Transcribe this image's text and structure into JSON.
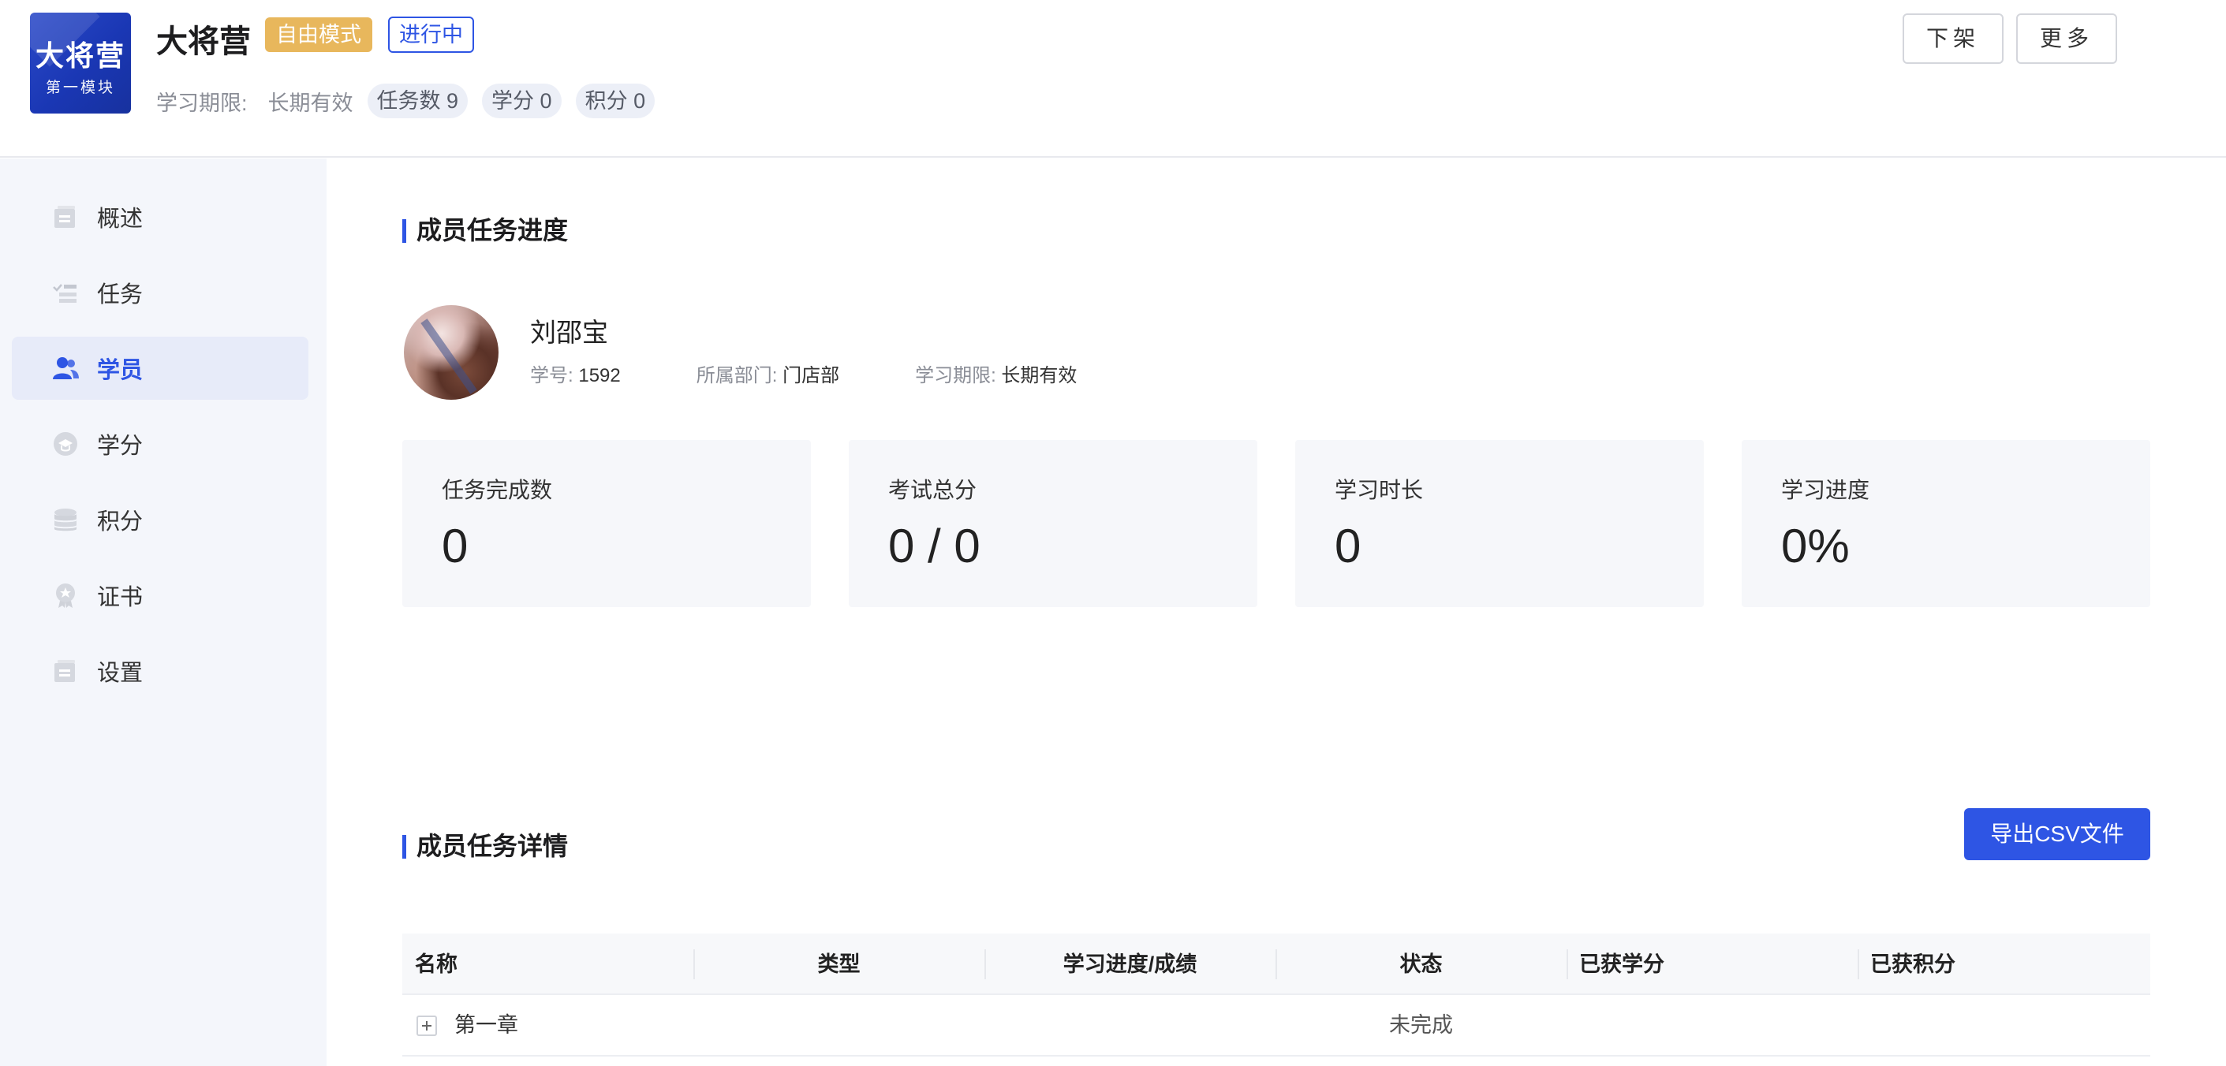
{
  "header": {
    "cover": {
      "title": "大将营",
      "subtitle": "第一模块"
    },
    "course_title": "大将营",
    "tags": {
      "mode": "自由模式",
      "status": "进行中"
    },
    "meta": {
      "period_label": "学习期限:",
      "period_value": "长期有效",
      "tasks": "任务数 9",
      "credits": "学分 0",
      "points": "积分 0"
    },
    "buttons": {
      "offshelf": "下架",
      "more": "更多"
    }
  },
  "sidebar": {
    "items": [
      {
        "label": "概述",
        "icon": "overview-icon"
      },
      {
        "label": "任务",
        "icon": "task-list-icon"
      },
      {
        "label": "学员",
        "icon": "users-icon",
        "active": true
      },
      {
        "label": "学分",
        "icon": "credit-icon"
      },
      {
        "label": "积分",
        "icon": "points-icon"
      },
      {
        "label": "证书",
        "icon": "certificate-icon"
      },
      {
        "label": "设置",
        "icon": "settings-icon"
      }
    ]
  },
  "progress": {
    "section_title": "成员任务进度",
    "member": {
      "name": "刘邵宝",
      "id_label": "学号:",
      "id_value": "1592",
      "dept_label": "所属部门:",
      "dept_value": "门店部",
      "period_label": "学习期限:",
      "period_value": "长期有效"
    },
    "stats": [
      {
        "label": "任务完成数",
        "value": "0"
      },
      {
        "label": "考试总分",
        "value": "0 / 0"
      },
      {
        "label": "学习时长",
        "value": "0"
      },
      {
        "label": "学习进度",
        "value": "0%"
      }
    ]
  },
  "details": {
    "section_title": "成员任务详情",
    "export_label": "导出CSV文件",
    "columns": [
      "名称",
      "类型",
      "学习进度/成绩",
      "状态",
      "已获学分",
      "已获积分"
    ],
    "rows": [
      {
        "name": "第一章",
        "type": "",
        "progress": "",
        "status": "未完成",
        "credits": "",
        "points": ""
      }
    ]
  },
  "colors": {
    "accent": "#2e55e4",
    "tag_mode": "#e8b75c",
    "sidebar_bg": "#f4f6fb",
    "card_bg": "#f6f7fa"
  }
}
